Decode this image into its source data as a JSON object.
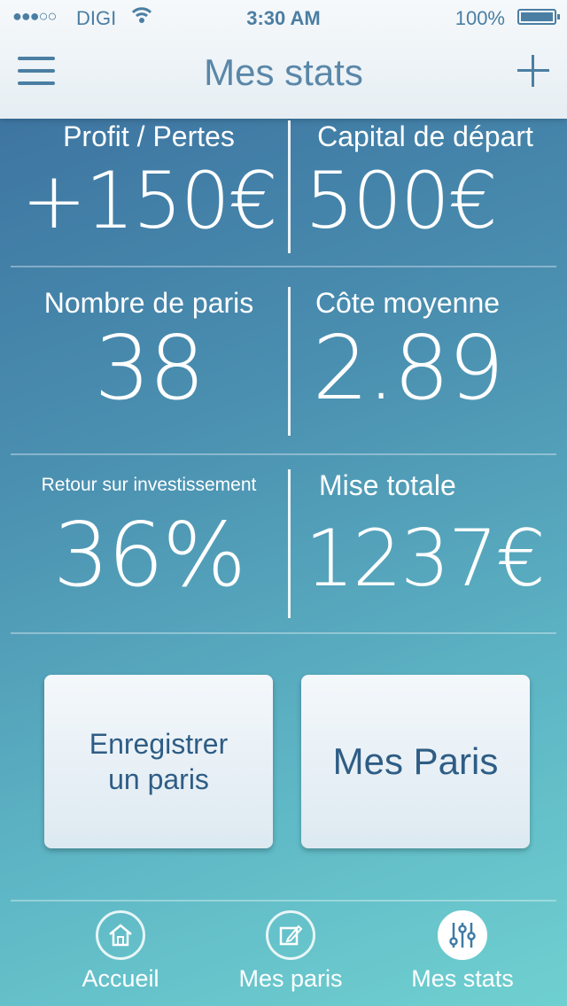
{
  "status_bar": {
    "signal": "●●●○○",
    "carrier": "DIGI",
    "time": "3:30 AM",
    "battery": "100%"
  },
  "nav": {
    "title": "Mes stats"
  },
  "stats": [
    {
      "label": "Profit / Pertes",
      "value": "+150€"
    },
    {
      "label": "Capital de départ",
      "value": "500€"
    },
    {
      "label": "Nombre de paris",
      "value": "38"
    },
    {
      "label": "Côte moyenne",
      "value": "2.89"
    },
    {
      "label": "Retour sur investissement",
      "value": "36%"
    },
    {
      "label": "Mise totale",
      "value": "1237€"
    }
  ],
  "actions": {
    "register_line1": "Enregistrer",
    "register_line2": "un paris",
    "my_bets": "Mes Paris"
  },
  "tabs": [
    {
      "label": "Accueil",
      "icon": "home-icon"
    },
    {
      "label": "Mes paris",
      "icon": "edit-icon"
    },
    {
      "label": "Mes stats",
      "icon": "sliders-icon"
    }
  ],
  "colors": {
    "accent": "#4b7ea3",
    "button_text": "#2e5d85"
  }
}
